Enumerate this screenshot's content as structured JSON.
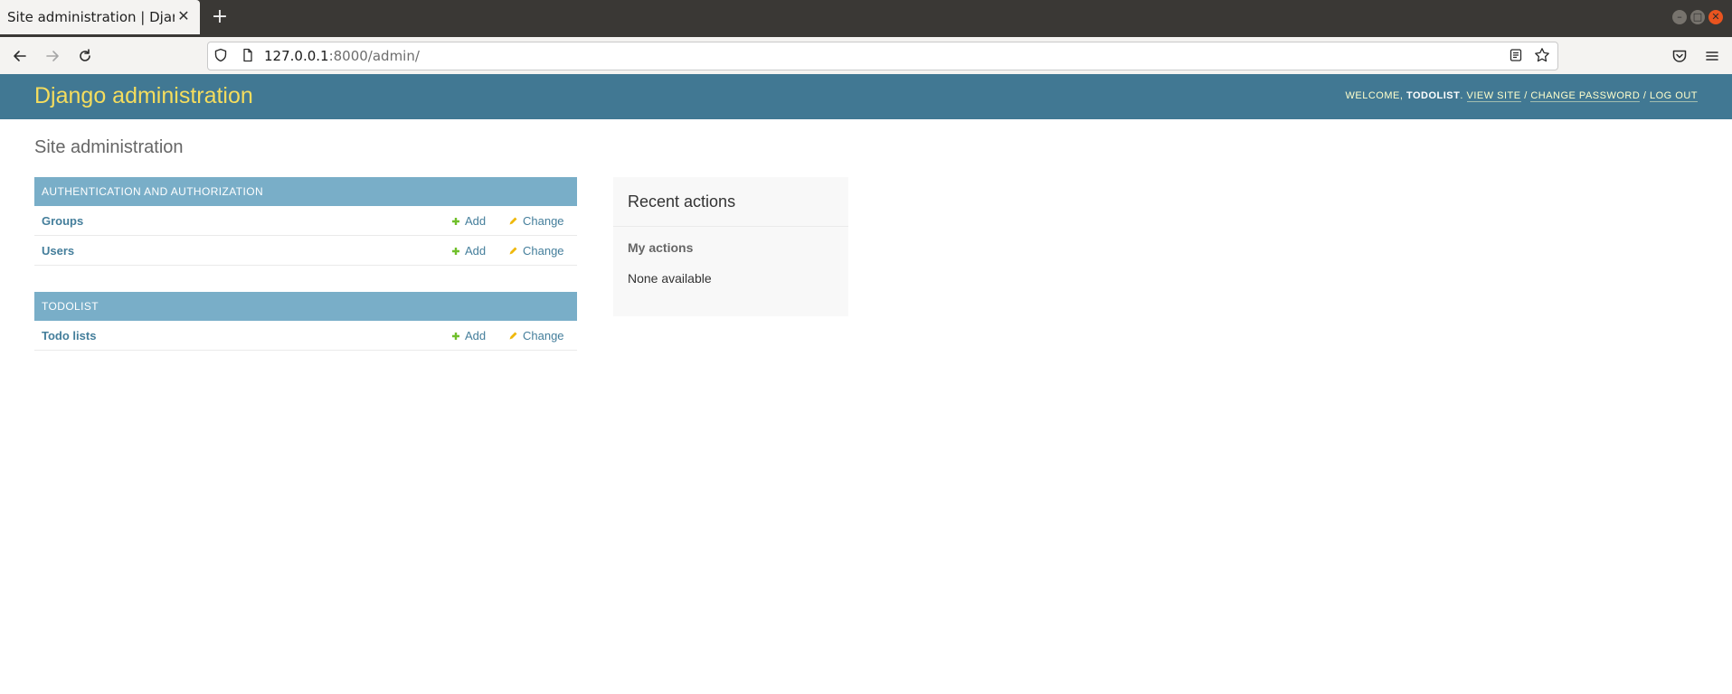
{
  "browser": {
    "tab_title": "Site administration | Django",
    "url_host": "127.0.0.1",
    "url_rest": ":8000/admin/"
  },
  "header": {
    "branding": "Django administration",
    "welcome": "WELCOME,",
    "username": "TODOLIST",
    "view_site": "VIEW SITE",
    "change_password": "CHANGE PASSWORD",
    "log_out": "LOG OUT",
    "separator": "/"
  },
  "page": {
    "title": "Site administration"
  },
  "apps": [
    {
      "caption": "Authentication and Authorization",
      "models": [
        {
          "name": "Groups",
          "add": "Add",
          "change": "Change"
        },
        {
          "name": "Users",
          "add": "Add",
          "change": "Change"
        }
      ]
    },
    {
      "caption": "Todolist",
      "models": [
        {
          "name": "Todo lists",
          "add": "Add",
          "change": "Change"
        }
      ]
    }
  ],
  "recent_actions": {
    "title": "Recent actions",
    "subtitle": "My actions",
    "empty_text": "None available"
  },
  "colors": {
    "header_bg": "#417893",
    "branding": "#f5dd5d",
    "caption_bg": "#79aec8",
    "link": "#447e9b",
    "add_icon": "#70bf2b",
    "change_icon": "#efb80b"
  }
}
